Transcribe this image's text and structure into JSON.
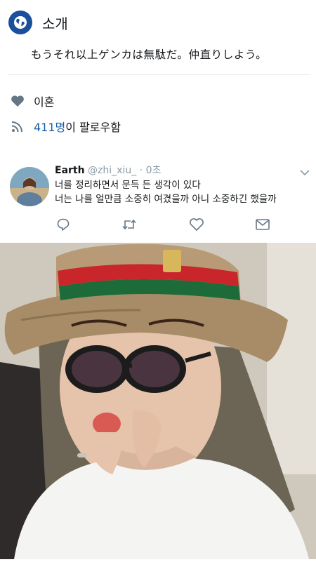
{
  "intro": {
    "title": "소개",
    "bio": "もうそれ以上ゲンカは無駄だ。仲直りしよう。"
  },
  "profile": {
    "relationship": "이혼",
    "followers_count": "411명",
    "followers_suffix": "이 팔로우함"
  },
  "tweet": {
    "author_name": "Earth",
    "author_handle": "@zhi_xiu_",
    "separator": " · ",
    "time": "0초",
    "lines": [
      "너를 정리하면서 문득 든 생각이 있다",
      "너는 나를 얼만큼 소중히 여겼을까 아니 소중하긴 했을까"
    ]
  },
  "icons": {
    "intro": "globe-icon",
    "relationship": "heart-icon",
    "followers": "rss-icon",
    "reply": "reply-icon",
    "retweet": "retweet-icon",
    "like": "like-icon",
    "message": "message-icon",
    "menu": "chevron-down-icon"
  },
  "colors": {
    "accent": "#1b5fa8",
    "muted": "#8a9aa8",
    "icon": "#657786",
    "badge": "#1a4f9c"
  }
}
